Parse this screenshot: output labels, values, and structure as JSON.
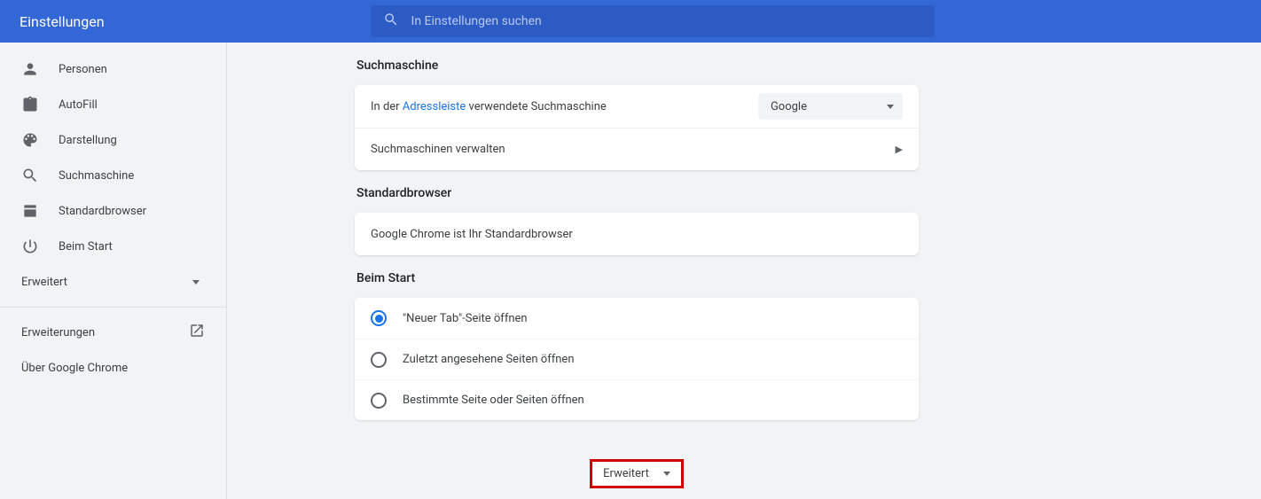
{
  "header": {
    "title": "Einstellungen",
    "search_placeholder": "In Einstellungen suchen"
  },
  "sidebar": {
    "items": [
      {
        "label": "Personen"
      },
      {
        "label": "AutoFill"
      },
      {
        "label": "Darstellung"
      },
      {
        "label": "Suchmaschine"
      },
      {
        "label": "Standardbrowser"
      },
      {
        "label": "Beim Start"
      }
    ],
    "advanced": "Erweitert",
    "extensions": "Erweiterungen",
    "about": "Über Google Chrome"
  },
  "search_engine": {
    "title": "Suchmaschine",
    "used_in_prefix": "In der ",
    "used_in_link": "Adressleiste",
    "used_in_suffix": " verwendete Suchmaschine",
    "selected": "Google",
    "manage": "Suchmaschinen verwalten"
  },
  "default_browser": {
    "title": "Standardbrowser",
    "status": "Google Chrome ist Ihr Standardbrowser"
  },
  "on_startup": {
    "title": "Beim Start",
    "options": [
      "\"Neuer Tab\"-Seite öffnen",
      "Zuletzt angesehene Seiten öffnen",
      "Bestimmte Seite oder Seiten öffnen"
    ],
    "selected_index": 0
  },
  "advanced_button": "Erweitert"
}
